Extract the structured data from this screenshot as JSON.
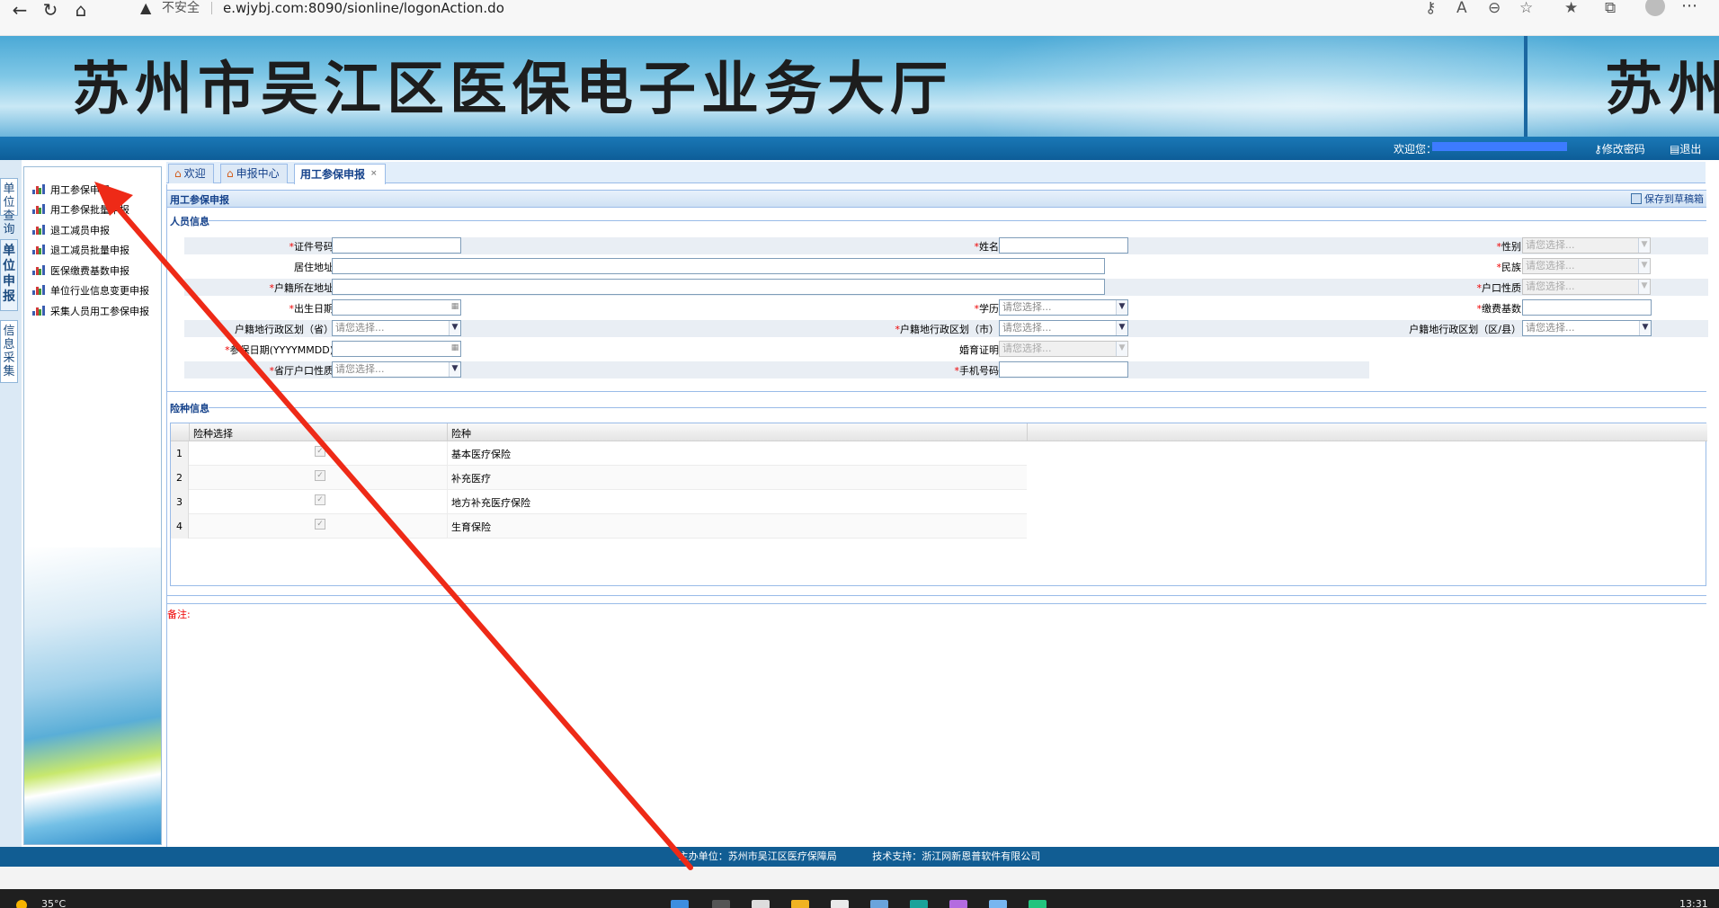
{
  "browser": {
    "back_icon": "back-arrow-icon",
    "refresh_icon": "refresh-icon",
    "home_icon": "home-icon",
    "security_label": "不安全",
    "url": "e.wjybj.com:8090/sionline/logonAction.do"
  },
  "banner": {
    "title": "苏州市吴江区医保电子业务大厅",
    "title_repeat": "苏州"
  },
  "topbar": {
    "welcome": "欢迎您：",
    "change_password": "修改密码",
    "exit": "退出"
  },
  "left_tabs": [
    {
      "label": "单位查询"
    },
    {
      "label": "单位申报"
    },
    {
      "label": "信息采集"
    }
  ],
  "menu": [
    {
      "label": "用工参保申报"
    },
    {
      "label": "用工参保批量申报"
    },
    {
      "label": "退工减员申报"
    },
    {
      "label": "退工减员批量申报"
    },
    {
      "label": "医保缴费基数申报"
    },
    {
      "label": "单位行业信息变更申报"
    },
    {
      "label": "采集人员用工参保申报"
    }
  ],
  "tabs": [
    {
      "label": "欢迎",
      "icon": "home-icon"
    },
    {
      "label": "申报中心",
      "icon": "home-icon"
    },
    {
      "label": "用工参保申报",
      "active": true
    }
  ],
  "panel": {
    "title": "用工参保申报",
    "save_draft": "保存到草稿箱"
  },
  "person_section": "人员信息",
  "form": {
    "id_no": {
      "label": "证件号码",
      "value": ""
    },
    "name": {
      "label": "姓名",
      "value": ""
    },
    "gender": {
      "label": "性别",
      "placeholder": "请您选择..."
    },
    "address": {
      "label": "居住地址",
      "value": ""
    },
    "ethnicity": {
      "label": "民族",
      "placeholder": "请您选择..."
    },
    "hukou_address": {
      "label": "户籍所在地址",
      "value": ""
    },
    "hukou_type": {
      "label": "户口性质",
      "placeholder": "请您选择..."
    },
    "birth_date": {
      "label": "出生日期",
      "value": ""
    },
    "education": {
      "label": "学历",
      "placeholder": "请您选择..."
    },
    "base_pay": {
      "label": "缴费基数",
      "value": ""
    },
    "region_province": {
      "label": "户籍地行政区划（省）",
      "placeholder": "请您选择..."
    },
    "region_city": {
      "label": "户籍地行政区划（市）",
      "placeholder": "请您选择..."
    },
    "region_county": {
      "label": "户籍地行政区划（区/县）",
      "placeholder": "请您选择..."
    },
    "join_date": {
      "label": "参保日期(YYYYMMDD)",
      "value": ""
    },
    "birth_cert": {
      "label": "婚育证明",
      "placeholder": "请您选择..."
    },
    "province_hukou": {
      "label": "省厅户口性质",
      "placeholder": "请您选择..."
    },
    "phone": {
      "label": "手机号码",
      "value": ""
    }
  },
  "insurance_section": "险种信息",
  "insurance_grid": {
    "headers": [
      "险种选择",
      "险种"
    ],
    "rows": [
      {
        "no": "1",
        "name": "基本医疗保险",
        "checked": "✓"
      },
      {
        "no": "2",
        "name": "补充医疗",
        "checked": "✓"
      },
      {
        "no": "3",
        "name": "地方补充医疗保险",
        "checked": "✓"
      },
      {
        "no": "4",
        "name": "生育保险",
        "checked": "✓"
      }
    ]
  },
  "remark_label": "备注:",
  "footer": {
    "host": "主办单位：苏州市吴江区医疗保障局",
    "support": "技术支持：浙江网新恩普软件有限公司"
  },
  "taskbar": {
    "temperature": "35°C",
    "time": "13:31"
  },
  "colors": {
    "header_blue": "#115d93",
    "panel_text": "#15428b",
    "required_red": "#e00000",
    "annotation_red": "#ee2a17"
  }
}
